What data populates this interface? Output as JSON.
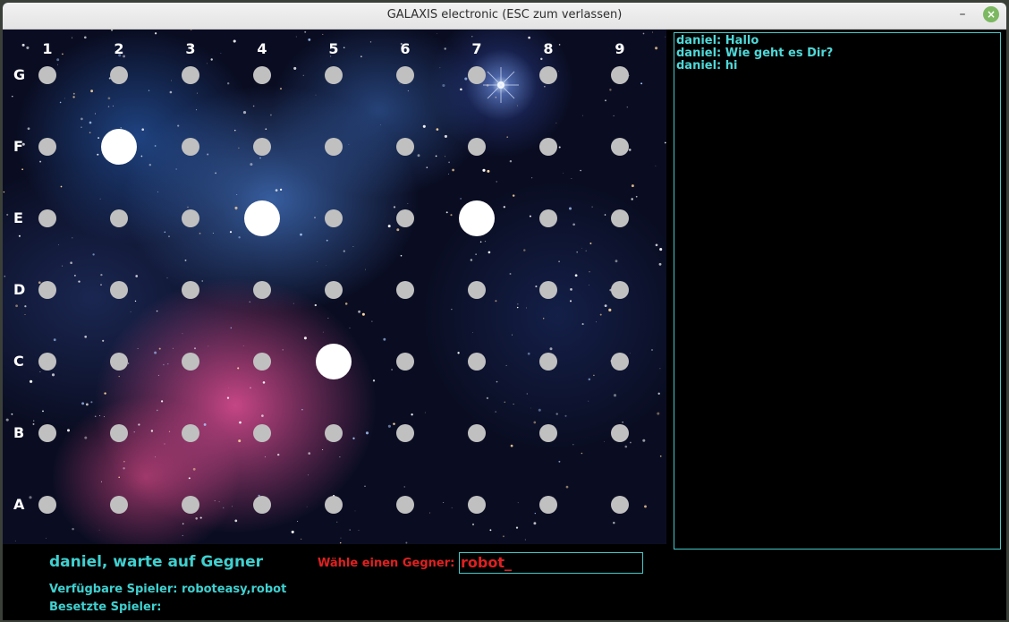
{
  "window": {
    "title": "GALAXIS electronic  (ESC zum verlassen)",
    "minimize_glyph": "–",
    "close_glyph": "×"
  },
  "board": {
    "columns": [
      "1",
      "2",
      "3",
      "4",
      "5",
      "6",
      "7",
      "8",
      "9"
    ],
    "rows": [
      "G",
      "F",
      "E",
      "D",
      "C",
      "B",
      "A"
    ],
    "hits": [
      {
        "row": "F",
        "col": "2"
      },
      {
        "row": "E",
        "col": "4"
      },
      {
        "row": "E",
        "col": "7"
      },
      {
        "row": "C",
        "col": "5"
      }
    ]
  },
  "chat": {
    "messages": [
      "daniel: Hallo",
      "daniel: Wie geht es Dir?",
      "daniel: hi"
    ]
  },
  "footer": {
    "status": "daniel, warte auf Gegner",
    "opponent_prompt": "Wähle einen Gegner:",
    "opponent_input": "robot_",
    "available_players": "Verfügbare Spieler: roboteasy,robot",
    "busy_players": "Besetzte Spieler:"
  },
  "colors": {
    "accent_cyan": "#40d0d0",
    "prompt_red": "#e02020",
    "hole_gray": "#c0c0c0",
    "hit_white": "#ffffff"
  },
  "icons": {
    "minimize": "minimize-icon",
    "close": "close-icon"
  }
}
